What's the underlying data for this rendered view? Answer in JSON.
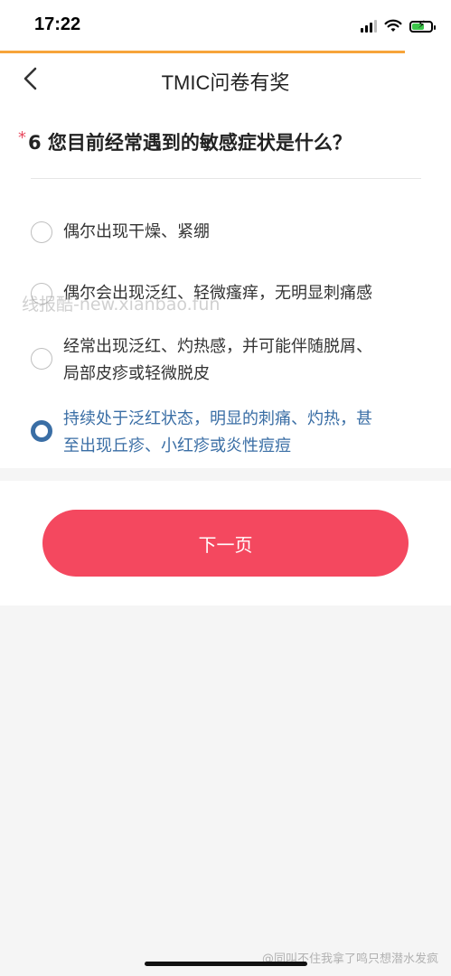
{
  "status_bar": {
    "time": "17:22",
    "icons": [
      "signal-icon",
      "wifi-icon",
      "battery-charging-icon"
    ]
  },
  "nav": {
    "title": "TMIC问卷有奖",
    "back_icon": "chevron-left-icon"
  },
  "question": {
    "required_mark": "*",
    "text": "6 您目前经常遇到的敏感症状是什么？"
  },
  "options": [
    {
      "label": "偶尔出现干燥、紧绷",
      "selected": false
    },
    {
      "label": "偶尔会出现泛红、轻微瘙痒，无明显刺痛感",
      "selected": false
    },
    {
      "label_line1": "经常出现泛红、灼热感，并可能伴随脱屑、",
      "label_line2": "局部皮疹或轻微脱皮",
      "selected": false
    },
    {
      "label_line1": "持续处于泛红状态，明显的刺痛、灼热，甚",
      "label_line2": "至出现丘疹、小红疹或炎性痘痘",
      "selected": true
    }
  ],
  "next_button": {
    "label": "下一页"
  },
  "watermarks": {
    "middle": "线报酷-new.xianbao.fun",
    "bottom": "@同叫不住我拿了鸣只想潜水发疯"
  },
  "colors": {
    "accent_blue": "#3a6ea5",
    "button_red": "#f4485f",
    "progress_orange": "#f7a43a",
    "required_red": "#e84a5f"
  }
}
